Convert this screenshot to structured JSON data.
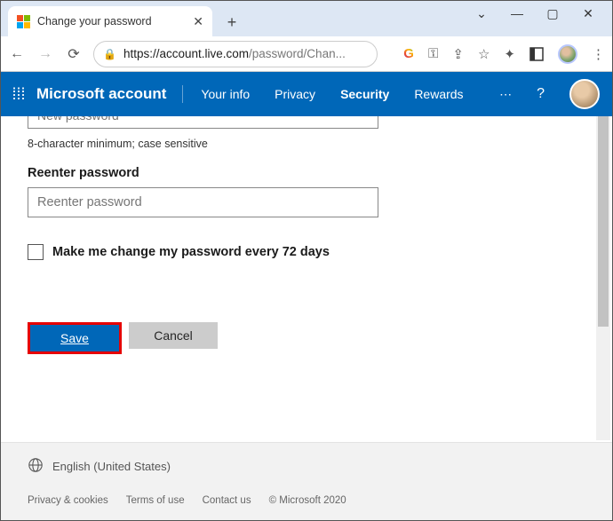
{
  "window": {
    "tab_title": "Change your password",
    "url_host": "https://account.live.com",
    "url_path": "/password/Chan..."
  },
  "nav": {
    "brand": "Microsoft account",
    "items": [
      "Your info",
      "Privacy",
      "Security",
      "Rewards"
    ],
    "active_index": 2,
    "more": "⋯",
    "help": "?"
  },
  "form": {
    "new_password_placeholder": "New password",
    "hint": "8-character minimum; case sensitive",
    "reenter_label": "Reenter password",
    "reenter_placeholder": "Reenter password",
    "checkbox_label": "Make me change my password every 72 days",
    "save": "Save",
    "cancel": "Cancel"
  },
  "footer": {
    "language": "English (United States)",
    "links": [
      "Privacy & cookies",
      "Terms of use",
      "Contact us"
    ],
    "copyright": "© Microsoft 2020"
  }
}
